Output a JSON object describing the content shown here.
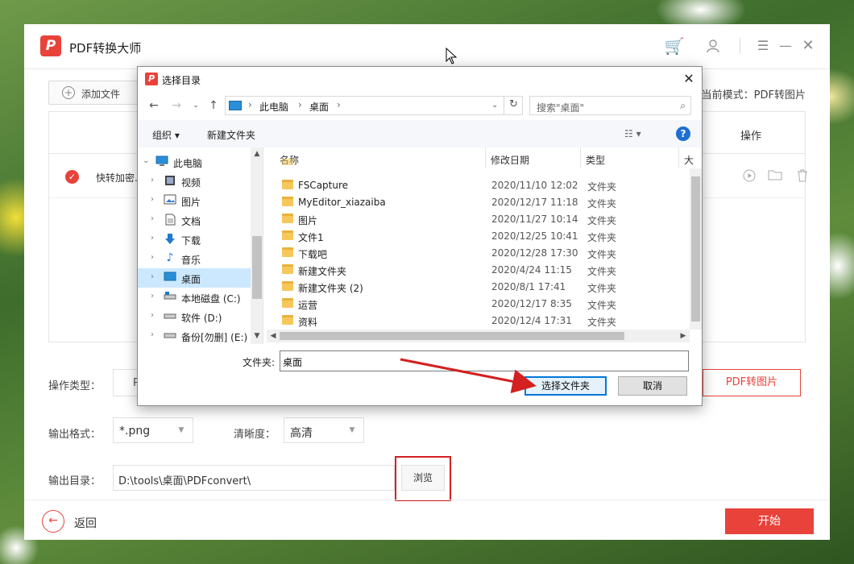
{
  "app": {
    "title": "PDF转换大师",
    "logo_letter": "P"
  },
  "toolbar": {
    "add_file_label": "添加文件",
    "current_mode": "当前模式：PDF转图片"
  },
  "table": {
    "op_header": "操作",
    "rows": [
      {
        "name": "快转加密..."
      }
    ]
  },
  "settings": {
    "op_type_label": "操作类型：",
    "op_type_first": "P",
    "pdf_to_image_label": "PDF转图片",
    "format_label": "输出格式：",
    "format_value": "*.png",
    "clarity_label": "清晰度：",
    "clarity_value": "高清",
    "output_dir_label": "输出目录：",
    "output_dir_value": "D:\\tools\\桌面\\PDFconvert\\",
    "browse_label": "浏览"
  },
  "footer": {
    "back_label": "返回",
    "start_label": "开始"
  },
  "dialog": {
    "title": "选择目录",
    "breadcrumb": [
      "此电脑",
      "桌面"
    ],
    "search_placeholder": "搜索\"桌面\"",
    "organize_label": "组织 ▾",
    "new_folder_label": "新建文件夹",
    "tree": [
      {
        "label": "此电脑",
        "icon": "computer-icon"
      },
      {
        "label": "视频",
        "icon": "video-icon"
      },
      {
        "label": "图片",
        "icon": "pictures-icon"
      },
      {
        "label": "文档",
        "icon": "documents-icon"
      },
      {
        "label": "下载",
        "icon": "downloads-icon"
      },
      {
        "label": "音乐",
        "icon": "music-icon"
      },
      {
        "label": "桌面",
        "icon": "desktop-icon",
        "selected": true
      },
      {
        "label": "本地磁盘 (C:)",
        "icon": "drive-icon"
      },
      {
        "label": "软件 (D:)",
        "icon": "drive-icon"
      },
      {
        "label": "备份[勿删] (E:)",
        "icon": "drive-icon"
      }
    ],
    "columns": {
      "name": "名称",
      "date": "修改日期",
      "type": "类型",
      "extra": "大"
    },
    "files": [
      {
        "name": "FSCapture",
        "date": "2020/11/10 12:02",
        "type": "文件夹"
      },
      {
        "name": "MyEditor_xiazaiba",
        "date": "2020/12/17 11:18",
        "type": "文件夹"
      },
      {
        "name": "图片",
        "date": "2020/11/27 10:14",
        "type": "文件夹"
      },
      {
        "name": "文件1",
        "date": "2020/12/25 10:41",
        "type": "文件夹"
      },
      {
        "name": "下载吧",
        "date": "2020/12/28 17:30",
        "type": "文件夹"
      },
      {
        "name": "新建文件夹",
        "date": "2020/4/24 11:15",
        "type": "文件夹"
      },
      {
        "name": "新建文件夹 (2)",
        "date": "2020/8/1 17:41",
        "type": "文件夹"
      },
      {
        "name": "运营",
        "date": "2020/12/17 8:35",
        "type": "文件夹"
      },
      {
        "name": "资料",
        "date": "2020/12/4 17:31",
        "type": "文件夹"
      }
    ],
    "folder_label": "文件夹:",
    "folder_value": "桌面",
    "select_button": "选择文件夹",
    "cancel_button": "取消"
  },
  "colors": {
    "accent": "#e8423a",
    "highlight_box": "#d32020",
    "dialog_focus": "#0078d7"
  }
}
